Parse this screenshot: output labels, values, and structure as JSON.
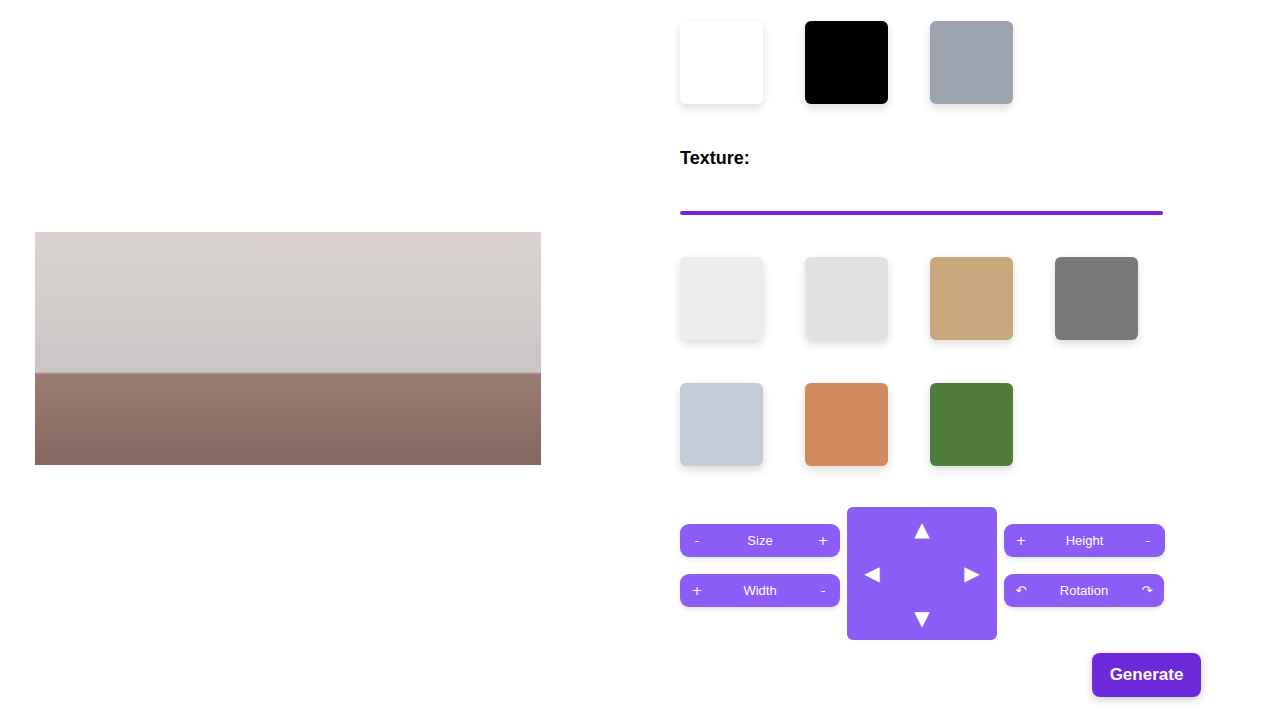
{
  "colors": [
    {
      "color": "#ffffff"
    },
    {
      "color": "#000000"
    },
    {
      "color": "#9ca3af"
    }
  ],
  "texture": {
    "label": "Texture:",
    "items": [
      {
        "color": "#ededee"
      },
      {
        "color": "#e2e2e5"
      },
      {
        "color": "#c9a87d"
      },
      {
        "color": "#77797b"
      },
      {
        "color": "#c3cbd8"
      },
      {
        "color": "#d08a5d"
      },
      {
        "color": "#4f7b3b"
      }
    ]
  },
  "controls": {
    "size": {
      "left": "-",
      "label": "Size",
      "right": "+"
    },
    "width": {
      "left": "+",
      "label": "Width",
      "right": "-"
    },
    "height": {
      "left": "+",
      "label": "Height",
      "right": "-"
    },
    "rotation": {
      "left": "↶",
      "label": "Rotation",
      "right": "↷"
    },
    "arrows": {
      "up": "▲",
      "left": "◀",
      "right": "▶",
      "down": "▼"
    }
  },
  "generate": "Generate"
}
